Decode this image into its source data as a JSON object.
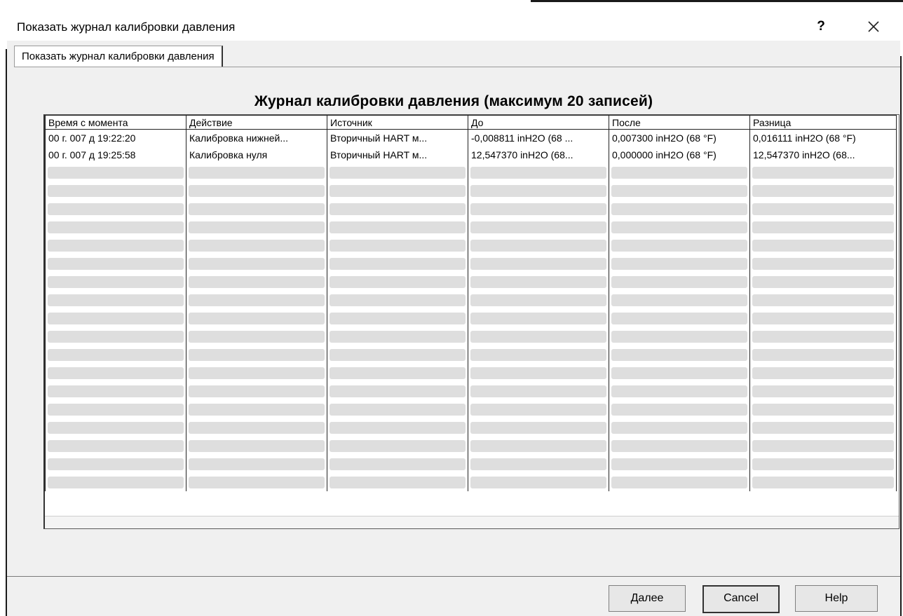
{
  "window": {
    "title": "Показать журнал калибровки давления",
    "help_label": "?",
    "close_icon": "close-icon"
  },
  "tab": {
    "label": "Показать журнал калибровки давления"
  },
  "heading": "Журнал калибровки давления (максимум 20 записей)",
  "table": {
    "columns": [
      "Время с момента",
      "Действие",
      "Источник",
      "До",
      "После",
      "Разница"
    ],
    "rows": [
      [
        "00 г. 007 д 19:22:20",
        "Калибровка нижней...",
        "Вторичный HART м...",
        "-0,008811 inH2O (68 ...",
        "0,007300 inH2O (68 °F)",
        "0,016111 inH2O (68 °F)"
      ],
      [
        "00 г. 007 д 19:25:58",
        "Калибровка нуля",
        "Вторичный HART м...",
        "12,547370 inH2O (68...",
        "0,000000 inH2O (68 °F)",
        "12,547370 inH2O (68..."
      ]
    ],
    "empty_rows": 18
  },
  "buttons": {
    "next": "Далее",
    "cancel": "Cancel",
    "help": "Help"
  }
}
